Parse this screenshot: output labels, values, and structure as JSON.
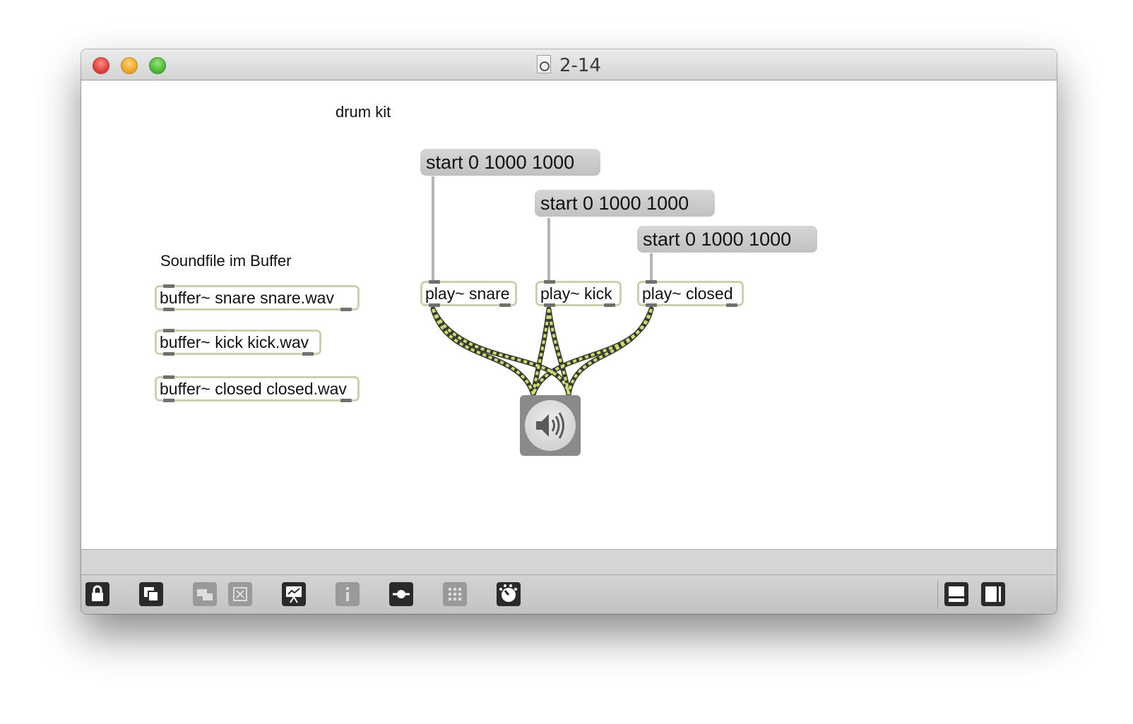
{
  "window": {
    "title": "2-14"
  },
  "canvas": {
    "comments": {
      "drum_kit": "drum kit",
      "soundfile": "Soundfile im Buffer"
    },
    "messages": {
      "msg1": "start 0 1000 1000",
      "msg2": "start 0 1000 1000",
      "msg3": "start 0 1000 1000"
    },
    "objects": {
      "play_snare": "play~ snare",
      "play_kick": "play~ kick",
      "play_closed": "play~ closed",
      "buffer_snare": "buffer~ snare snare.wav",
      "buffer_kick": "buffer~ kick kick.wav",
      "buffer_closed": "buffer~ closed closed.wav"
    },
    "dac": {
      "icon": "speaker-icon"
    }
  },
  "colors": {
    "audio_patch_cord": "#c9dd77",
    "control_patch_cord": "#b0b0b0",
    "object_border": "#c9d2b0",
    "message_box": "#c6c6c6"
  },
  "toolbar": {
    "buttons": [
      "lock-icon",
      "new-view-icon",
      "paste-replace-icon",
      "clear-icon",
      "presentation-icon",
      "inspector-icon",
      "object-palette-icon",
      "grid-icon",
      "dsp-icon"
    ],
    "right_buttons": [
      "bottom-pane-icon",
      "right-pane-icon"
    ]
  }
}
